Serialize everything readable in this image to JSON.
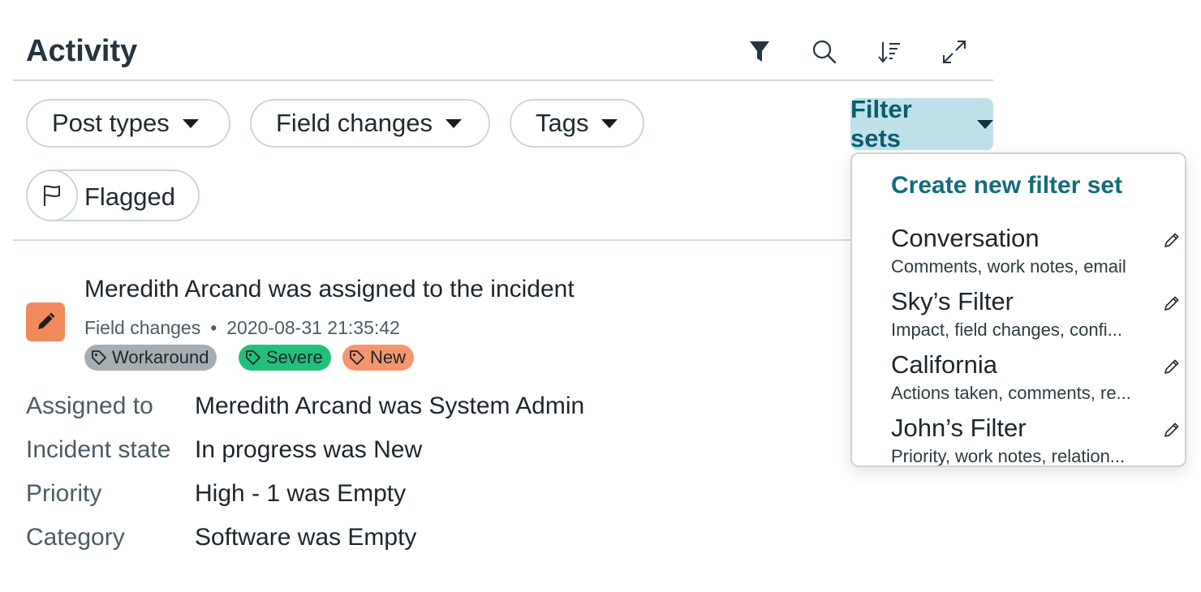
{
  "header": {
    "title": "Activity"
  },
  "toolbar": {
    "icons": [
      "filter-icon",
      "search-icon",
      "sort-icon",
      "expand-icon"
    ]
  },
  "filters": {
    "post_types": "Post types",
    "field_changes": "Field changes",
    "tags": "Tags",
    "filter_sets": "Filter sets",
    "flagged": "Flagged"
  },
  "entry": {
    "title": "Meredith Arcand was assigned to the incident",
    "type": "Field changes",
    "timestamp": "2020-08-31 21:35:42",
    "tags": [
      {
        "label": "Workaround",
        "color": "#a7adb0"
      },
      {
        "label": "Severe",
        "color": "#22c07a"
      },
      {
        "label": "New",
        "color": "#f4956d"
      }
    ],
    "fields": [
      {
        "label": "Assigned to",
        "value": "Meredith Arcand was System Admin"
      },
      {
        "label": "Incident state",
        "value": "In progress was New"
      },
      {
        "label": "Priority",
        "value": "High - 1 was Empty"
      },
      {
        "label": "Category",
        "value": "Software was Empty"
      }
    ]
  },
  "dropdown": {
    "create_label": "Create new filter set",
    "items": [
      {
        "name": "Conversation",
        "desc": "Comments, work notes, email"
      },
      {
        "name": "Sky’s Filter",
        "desc": "Impact, field changes, confi..."
      },
      {
        "name": "California",
        "desc": "Actions taken, comments, re..."
      },
      {
        "name": "John’s Filter",
        "desc": "Priority, work notes, relation..."
      }
    ]
  },
  "colors": {
    "accent": "#146a7d",
    "filter_sets_bg": "#bfe2ea",
    "entry_icon_bg": "#f08a5d"
  }
}
